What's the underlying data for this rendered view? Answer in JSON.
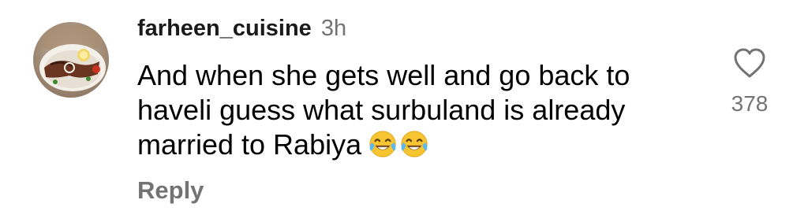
{
  "comment": {
    "username": "farheen_cuisine",
    "timestamp": "3h",
    "text": "And when she gets well and go back to haveli guess what surbuland is already married to Rabiya",
    "emojis": [
      "face-with-tears-of-joy-emoji",
      "face-with-tears-of-joy-emoji"
    ],
    "reply_label": "Reply",
    "like_count": "378",
    "like_icon": "heart-outline-icon",
    "avatar_icon": "food-plate-avatar"
  },
  "colors": {
    "secondary_text": "#737373",
    "primary_text": "#000000"
  }
}
